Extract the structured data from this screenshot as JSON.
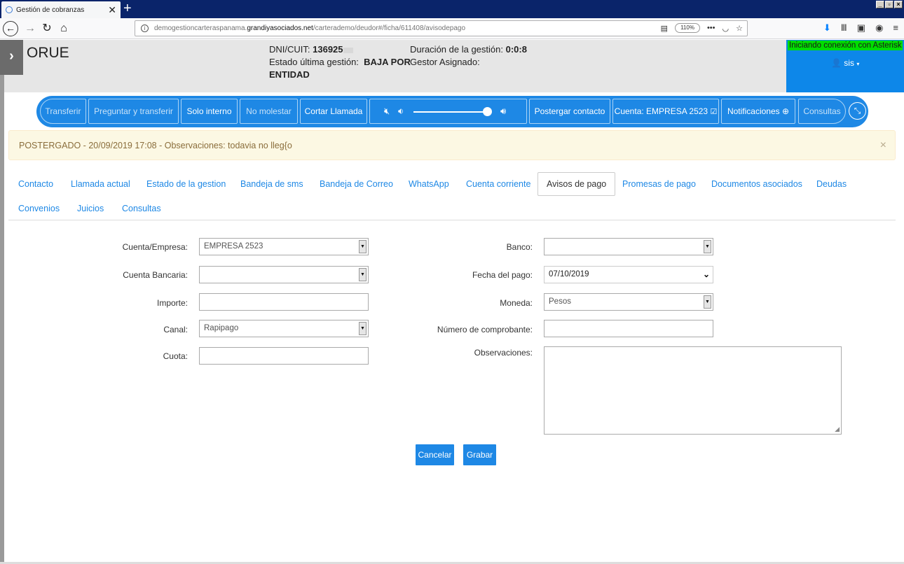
{
  "browser": {
    "tab_title": "Gestión de cobranzas",
    "tab_close": "✕",
    "new_tab": "+",
    "url_prefix": "demogestioncarteraspanama.",
    "url_domain": "grandiyasociados.net",
    "url_path": "/carterademo/deudor#/ficha/611408/avisodepago",
    "zoom": "110%"
  },
  "header": {
    "client_name": "ORUE",
    "dni_label": "DNI/CUIT:",
    "dni_value": "136925",
    "estado_label": "Estado última gestión:",
    "estado_value_1": "BAJA POR",
    "estado_value_2": "ENTIDAD",
    "duracion_label": "Duración de la gestión:",
    "duracion_value": "0:0:8",
    "gestor_label": "Gestor Asignado:",
    "asterisk_status": "Iniciando conexión con Asterisk",
    "user": "sis"
  },
  "phonebar": {
    "transferir": "Transferir",
    "preguntar": "Preguntar y transferir",
    "solo_interno": "Solo interno",
    "no_molestar": "No molestar",
    "cortar": "Cortar Llamada",
    "volume_level": 0.95,
    "postergar": "Postergar contacto",
    "cuenta": "Cuenta: EMPRESA 2523",
    "notificaciones": "Notificaciones",
    "consultas": "Consultas"
  },
  "alert": {
    "text": "POSTERGADO - 20/09/2019 17:08 - Observaciones: todavia no lleg{o",
    "close": "×"
  },
  "tabs": {
    "contacto": "Contacto",
    "llamada": "Llamada actual",
    "estado": "Estado de la gestion",
    "sms": "Bandeja de sms",
    "correo": "Bandeja de Correo",
    "whatsapp": "WhatsApp",
    "cuenta_corriente": "Cuenta corriente",
    "avisos": "Avisos de pago",
    "promesas": "Promesas de pago",
    "documentos": "Documentos asociados",
    "deudas": "Deudas",
    "convenios": "Convenios",
    "juicios": "Juicios",
    "consultas": "Consultas"
  },
  "form": {
    "cuenta_empresa_label": "Cuenta/Empresa:",
    "cuenta_empresa_value": "EMPRESA 2523",
    "cuenta_bancaria_label": "Cuenta Bancaria:",
    "cuenta_bancaria_value": "",
    "importe_label": "Importe:",
    "importe_value": "",
    "canal_label": "Canal:",
    "canal_value": "Rapipago",
    "cuota_label": "Cuota:",
    "cuota_value": "",
    "banco_label": "Banco:",
    "banco_value": "",
    "fecha_label": "Fecha del pago:",
    "fecha_value": "07/10/2019",
    "moneda_label": "Moneda:",
    "moneda_value": "Pesos",
    "comprobante_label": "Número de comprobante:",
    "comprobante_value": "",
    "observaciones_label": "Observaciones:",
    "cancelar": "Cancelar",
    "grabar": "Grabar"
  }
}
